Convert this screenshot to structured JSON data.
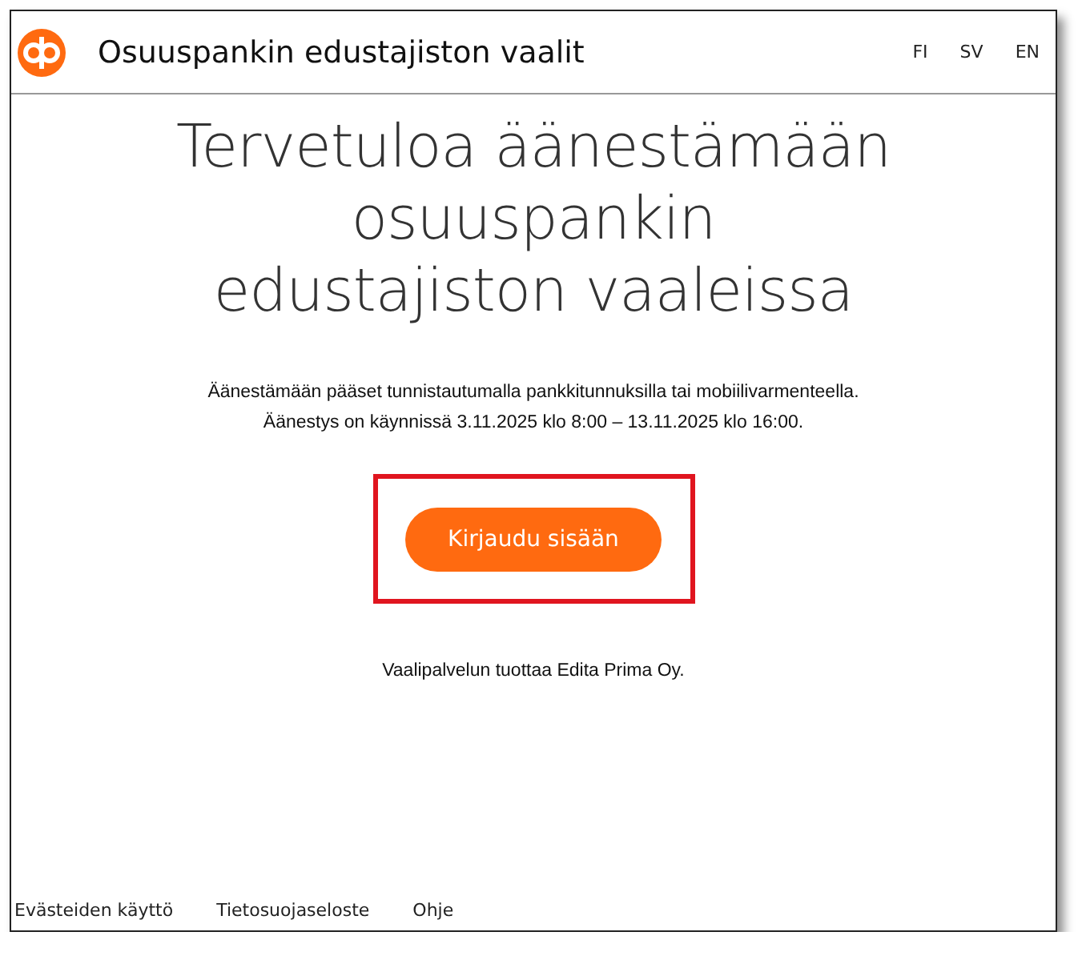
{
  "header": {
    "title": "Osuuspankin edustajiston vaalit",
    "languages": [
      {
        "label": "FI"
      },
      {
        "label": "SV"
      },
      {
        "label": "EN"
      }
    ]
  },
  "heading": "Tervetuloa äänestämään osuuspankin edustajiston vaaleissa",
  "intro": [
    "Äänestämään pääset tunnistautumalla pankkitunnuksilla tai mobiilivarmenteella.",
    "Äänestys on käynnissä 3.11.2025 klo 8:00 – 13.11.2025 klo 16:00."
  ],
  "login_button": {
    "label": "Kirjaudu sisään",
    "highlighted": true
  },
  "provider": "Vaalipalvelun tuottaa Edita Prima Oy.",
  "footer_links": [
    "Evästeiden käyttö",
    "Tietosuojaseloste",
    "Ohje"
  ]
}
